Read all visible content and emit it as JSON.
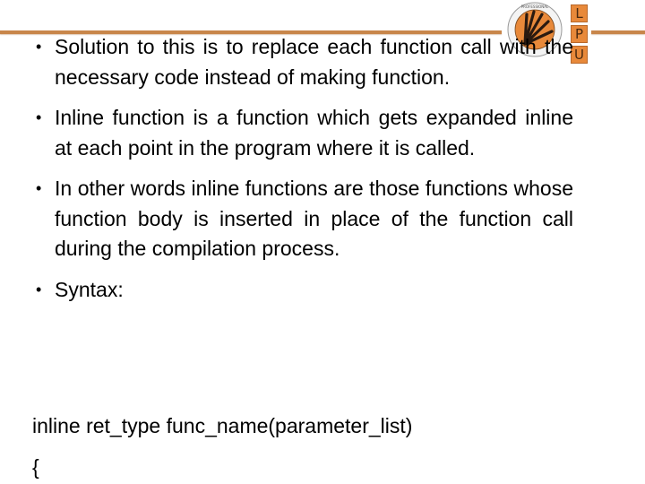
{
  "slide": {
    "bullets": [
      "Solution to this is to replace each function call with the necessary code instead of making function.",
      "Inline function is a function which gets expanded inline at each point in the program where it is called.",
      "In other words inline functions are those functions whose function body is inserted in place of the function call during the compilation process.",
      "Syntax:"
    ],
    "code_lines": [
      "inline ret_type  func_name(parameter_list)",
      "{"
    ]
  },
  "logo": {
    "seal_icon": "university-seal-icon",
    "seal_ring_text": "LOVELY PROFESSIONAL UNIVERSITY",
    "letters": [
      "L",
      "P",
      "U"
    ],
    "accent_color": "#e8893a",
    "line_color": "#c8864a"
  },
  "bullet_symbol": "•"
}
